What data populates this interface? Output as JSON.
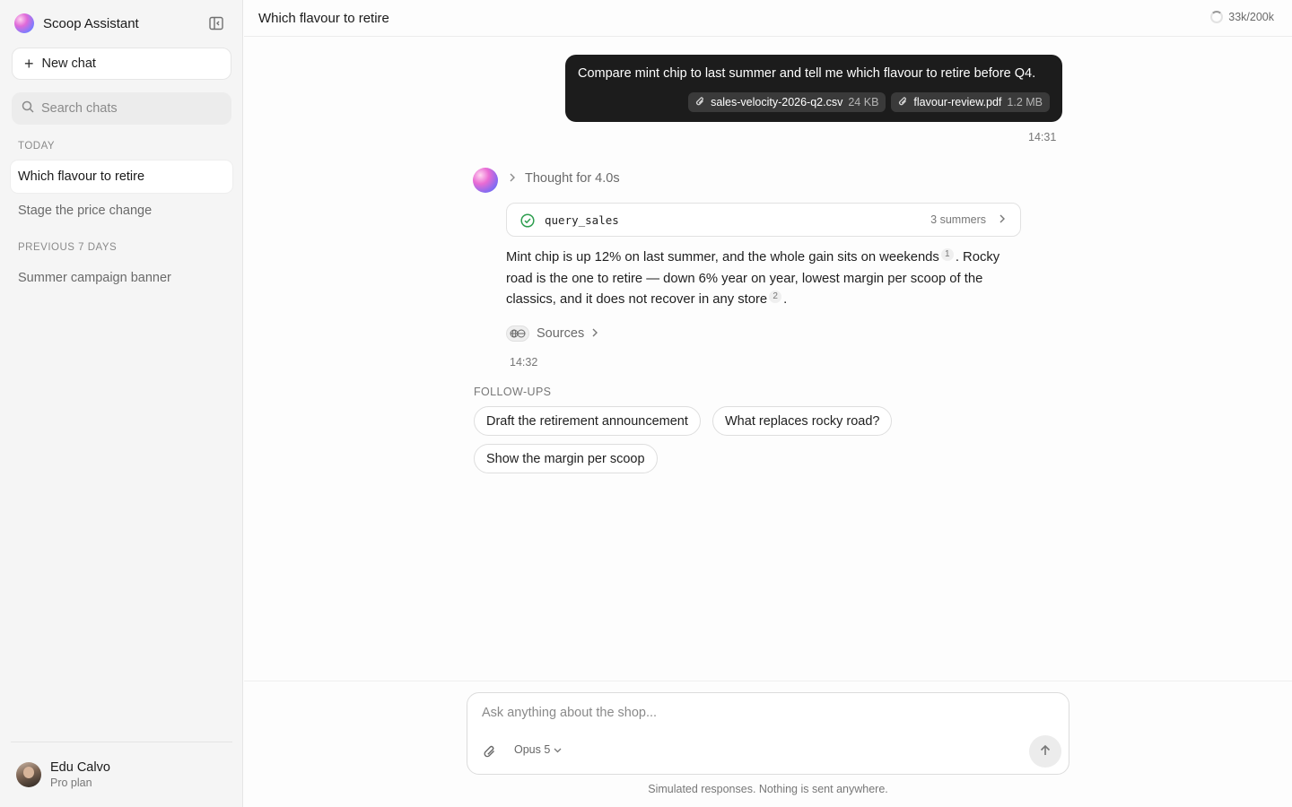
{
  "app": {
    "name": "Scoop Assistant"
  },
  "sidebar": {
    "new_chat_label": "New chat",
    "search_placeholder": "Search chats",
    "sections": [
      {
        "label": "Today",
        "items": [
          "Which flavour to retire",
          "Stage the price change"
        ]
      },
      {
        "label": "Previous 7 days",
        "items": [
          "Summer campaign banner"
        ]
      }
    ],
    "active_item": "Which flavour to retire",
    "user": {
      "name": "Edu Calvo",
      "plan": "Pro plan"
    }
  },
  "header": {
    "title": "Which flavour to retire",
    "tokens": "33k/200k"
  },
  "conversation": {
    "user_message": {
      "text": "Compare mint chip to last summer and tell me which flavour to retire before Q4.",
      "attachments": [
        {
          "name": "sales-velocity-2026-q2.csv",
          "size": "24 KB"
        },
        {
          "name": "flavour-review.pdf",
          "size": "1.2 MB"
        }
      ],
      "time": "14:31"
    },
    "assistant_message": {
      "thought_label": "Thought for 4.0s",
      "tool": {
        "name": "query_sales",
        "meta": "3 summers"
      },
      "answer_part1": "Mint chip is up 12% on last summer, and the whole gain sits on weekends",
      "cite1": "1",
      "answer_part2": ". Rocky road is the one to retire — down 6% year on year, lowest margin per scoop of the classics, and it does not recover in any store",
      "cite2": "2",
      "answer_part3": ".",
      "sources_label": "Sources",
      "time": "14:32"
    },
    "followups": {
      "label": "FOLLOW-UPS",
      "items": [
        "Draft the retirement announcement",
        "What replaces rocky road?",
        "Show the margin per scoop"
      ]
    }
  },
  "composer": {
    "placeholder": "Ask anything about the shop...",
    "model": "Opus 5",
    "disclaimer": "Simulated responses. Nothing is sent anywhere."
  },
  "colors": {
    "accent_user_bubble": "#1c1c1c",
    "success": "#2e9e4f"
  }
}
